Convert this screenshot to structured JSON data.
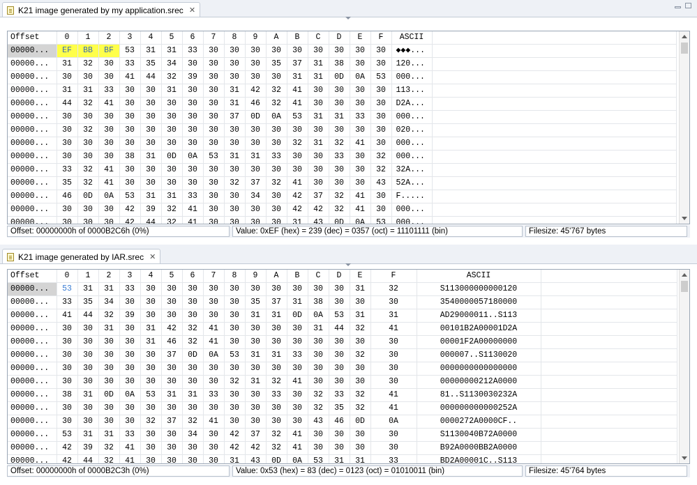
{
  "top": {
    "tab_title": "K21 image generated by my application.srec",
    "columns": [
      "Offset",
      "0",
      "1",
      "2",
      "3",
      "4",
      "5",
      "6",
      "7",
      "8",
      "9",
      "A",
      "B",
      "C",
      "D",
      "E",
      "F",
      "ASCII"
    ],
    "rows": [
      {
        "offset": "00000...",
        "bytes": [
          "EF",
          "BB",
          "BF",
          "53",
          "31",
          "31",
          "33",
          "30",
          "30",
          "30",
          "30",
          "30",
          "30",
          "30",
          "30",
          "30"
        ],
        "ascii": "◆◆◆..."
      },
      {
        "offset": "00000...",
        "bytes": [
          "31",
          "32",
          "30",
          "33",
          "35",
          "34",
          "30",
          "30",
          "30",
          "30",
          "35",
          "37",
          "31",
          "38",
          "30",
          "30"
        ],
        "ascii": "120..."
      },
      {
        "offset": "00000...",
        "bytes": [
          "30",
          "30",
          "30",
          "41",
          "44",
          "32",
          "39",
          "30",
          "30",
          "30",
          "30",
          "31",
          "31",
          "0D",
          "0A",
          "53"
        ],
        "ascii": "000..."
      },
      {
        "offset": "00000...",
        "bytes": [
          "31",
          "31",
          "33",
          "30",
          "30",
          "31",
          "30",
          "30",
          "31",
          "42",
          "32",
          "41",
          "30",
          "30",
          "30",
          "30"
        ],
        "ascii": "113..."
      },
      {
        "offset": "00000...",
        "bytes": [
          "44",
          "32",
          "41",
          "30",
          "30",
          "30",
          "30",
          "30",
          "31",
          "46",
          "32",
          "41",
          "30",
          "30",
          "30",
          "30"
        ],
        "ascii": "D2A..."
      },
      {
        "offset": "00000...",
        "bytes": [
          "30",
          "30",
          "30",
          "30",
          "30",
          "30",
          "30",
          "30",
          "37",
          "0D",
          "0A",
          "53",
          "31",
          "31",
          "33",
          "30"
        ],
        "ascii": "000..."
      },
      {
        "offset": "00000...",
        "bytes": [
          "30",
          "32",
          "30",
          "30",
          "30",
          "30",
          "30",
          "30",
          "30",
          "30",
          "30",
          "30",
          "30",
          "30",
          "30",
          "30"
        ],
        "ascii": "020..."
      },
      {
        "offset": "00000...",
        "bytes": [
          "30",
          "30",
          "30",
          "30",
          "30",
          "30",
          "30",
          "30",
          "30",
          "30",
          "30",
          "32",
          "31",
          "32",
          "41",
          "30"
        ],
        "ascii": "000..."
      },
      {
        "offset": "00000...",
        "bytes": [
          "30",
          "30",
          "30",
          "38",
          "31",
          "0D",
          "0A",
          "53",
          "31",
          "31",
          "33",
          "30",
          "30",
          "33",
          "30",
          "32"
        ],
        "ascii": "000..."
      },
      {
        "offset": "00000...",
        "bytes": [
          "33",
          "32",
          "41",
          "30",
          "30",
          "30",
          "30",
          "30",
          "30",
          "30",
          "30",
          "30",
          "30",
          "30",
          "30",
          "32"
        ],
        "ascii": "32A..."
      },
      {
        "offset": "00000...",
        "bytes": [
          "35",
          "32",
          "41",
          "30",
          "30",
          "30",
          "30",
          "30",
          "32",
          "37",
          "32",
          "41",
          "30",
          "30",
          "30",
          "43"
        ],
        "ascii": "52A..."
      },
      {
        "offset": "00000...",
        "bytes": [
          "46",
          "0D",
          "0A",
          "53",
          "31",
          "31",
          "33",
          "30",
          "30",
          "34",
          "30",
          "42",
          "37",
          "32",
          "41",
          "30"
        ],
        "ascii": "F....."
      },
      {
        "offset": "00000...",
        "bytes": [
          "30",
          "30",
          "30",
          "42",
          "39",
          "32",
          "41",
          "30",
          "30",
          "30",
          "30",
          "42",
          "42",
          "32",
          "41",
          "30"
        ],
        "ascii": "000..."
      },
      {
        "offset": "00000...",
        "bytes": [
          "30",
          "30",
          "30",
          "42",
          "44",
          "32",
          "41",
          "30",
          "30",
          "30",
          "30",
          "31",
          "43",
          "0D",
          "0A",
          "53"
        ],
        "ascii": "000..."
      }
    ],
    "status_offset": "Offset: 00000000h of 0000B2C6h (0%)",
    "status_value": "Value: 0xEF (hex) = 239 (dec) = 0357 (oct) = 11101111 (bin)",
    "status_filesize": "Filesize: 45'767 bytes"
  },
  "bottom": {
    "tab_title": "K21 image generated by IAR.srec",
    "columns": [
      "Offset",
      "0",
      "1",
      "2",
      "3",
      "4",
      "5",
      "6",
      "7",
      "8",
      "9",
      "A",
      "B",
      "C",
      "D",
      "E",
      "F",
      "ASCII"
    ],
    "rows": [
      {
        "offset": "00000...",
        "bytes": [
          "53",
          "31",
          "31",
          "33",
          "30",
          "30",
          "30",
          "30",
          "30",
          "30",
          "30",
          "30",
          "30",
          "30",
          "31",
          "32",
          "30"
        ],
        "ascii": "S113000000000120"
      },
      {
        "offset": "00000...",
        "bytes": [
          "33",
          "35",
          "34",
          "30",
          "30",
          "30",
          "30",
          "30",
          "30",
          "35",
          "37",
          "31",
          "38",
          "30",
          "30",
          "30"
        ],
        "ascii": "3540000057180000"
      },
      {
        "offset": "00000...",
        "bytes": [
          "41",
          "44",
          "32",
          "39",
          "30",
          "30",
          "30",
          "30",
          "30",
          "31",
          "31",
          "0D",
          "0A",
          "53",
          "31",
          "31",
          "33"
        ],
        "ascii": "AD29000011..S113"
      },
      {
        "offset": "00000...",
        "bytes": [
          "30",
          "30",
          "31",
          "30",
          "31",
          "42",
          "32",
          "41",
          "30",
          "30",
          "30",
          "30",
          "31",
          "44",
          "32",
          "41"
        ],
        "ascii": "00101B2A00001D2A"
      },
      {
        "offset": "00000...",
        "bytes": [
          "30",
          "30",
          "30",
          "30",
          "31",
          "46",
          "32",
          "41",
          "30",
          "30",
          "30",
          "30",
          "30",
          "30",
          "30",
          "30"
        ],
        "ascii": "00001F2A00000000"
      },
      {
        "offset": "00000...",
        "bytes": [
          "30",
          "30",
          "30",
          "30",
          "30",
          "37",
          "0D",
          "0A",
          "53",
          "31",
          "31",
          "33",
          "30",
          "30",
          "32",
          "30"
        ],
        "ascii": "000007..S1130020"
      },
      {
        "offset": "00000...",
        "bytes": [
          "30",
          "30",
          "30",
          "30",
          "30",
          "30",
          "30",
          "30",
          "30",
          "30",
          "30",
          "30",
          "30",
          "30",
          "30",
          "30"
        ],
        "ascii": "0000000000000000"
      },
      {
        "offset": "00000...",
        "bytes": [
          "30",
          "30",
          "30",
          "30",
          "30",
          "30",
          "30",
          "30",
          "32",
          "31",
          "32",
          "41",
          "30",
          "30",
          "30",
          "30"
        ],
        "ascii": "00000000212A0000"
      },
      {
        "offset": "00000...",
        "bytes": [
          "38",
          "31",
          "0D",
          "0A",
          "53",
          "31",
          "31",
          "33",
          "30",
          "30",
          "33",
          "30",
          "32",
          "33",
          "32",
          "41"
        ],
        "ascii": "81..S1130030232A"
      },
      {
        "offset": "00000...",
        "bytes": [
          "30",
          "30",
          "30",
          "30",
          "30",
          "30",
          "30",
          "30",
          "30",
          "30",
          "30",
          "30",
          "32",
          "35",
          "32",
          "41"
        ],
        "ascii": "000000000000252A"
      },
      {
        "offset": "00000...",
        "bytes": [
          "30",
          "30",
          "30",
          "30",
          "32",
          "37",
          "32",
          "41",
          "30",
          "30",
          "30",
          "30",
          "43",
          "46",
          "0D",
          "0A"
        ],
        "ascii": "0000272A0000CF.."
      },
      {
        "offset": "00000...",
        "bytes": [
          "53",
          "31",
          "31",
          "33",
          "30",
          "30",
          "34",
          "30",
          "42",
          "37",
          "32",
          "41",
          "30",
          "30",
          "30",
          "30"
        ],
        "ascii": "S1130040B72A0000"
      },
      {
        "offset": "00000...",
        "bytes": [
          "42",
          "39",
          "32",
          "41",
          "30",
          "30",
          "30",
          "30",
          "42",
          "42",
          "32",
          "41",
          "30",
          "30",
          "30",
          "30"
        ],
        "ascii": "B92A0000BB2A0000"
      },
      {
        "offset": "00000...",
        "bytes": [
          "42",
          "44",
          "32",
          "41",
          "30",
          "30",
          "30",
          "30",
          "31",
          "43",
          "0D",
          "0A",
          "53",
          "31",
          "31",
          "33"
        ],
        "ascii": "BD2A00001C..S113"
      }
    ],
    "status_offset": "Offset: 00000000h of 0000B2C3h (0%)",
    "status_value": "Value: 0x53 (hex) = 83 (dec) = 0123 (oct) = 01010011 (bin)",
    "status_filesize": "Filesize: 45'764 bytes"
  },
  "icons": {
    "file": "srec-file-icon",
    "close": "close-icon"
  },
  "colors": {
    "highlight": "#ffff4a",
    "cursor": "#3a7dd4"
  }
}
